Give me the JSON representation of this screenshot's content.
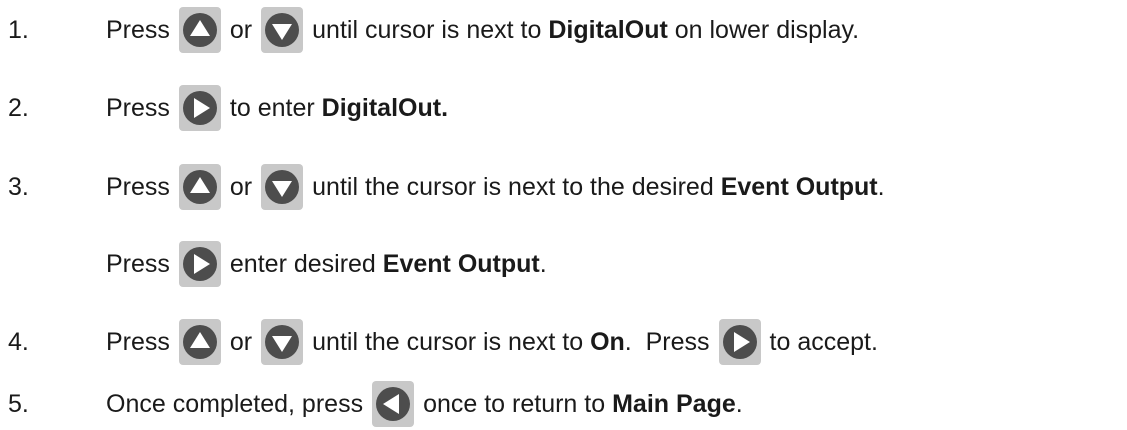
{
  "steps": [
    {
      "number": "1.",
      "parts": [
        "Press",
        "or",
        "until cursor is next to",
        "DigitalOut",
        "on lower display."
      ]
    },
    {
      "number": "2.",
      "parts": [
        "Press",
        "to enter",
        "DigitalOut."
      ]
    },
    {
      "number": "3.",
      "parts": [
        "Press",
        "or",
        "until the cursor is next to the desired",
        "Event Output",
        "."
      ]
    },
    {
      "number": "",
      "parts": [
        "Press",
        "enter desired",
        "Event Output",
        "."
      ]
    },
    {
      "number": "4.",
      "parts": [
        "Press",
        "or",
        "until the cursor is next to",
        "On",
        ".  Press",
        "to accept."
      ]
    },
    {
      "number": "5.",
      "parts": [
        "Once completed, press",
        "once to return to",
        "Main Page",
        "."
      ]
    }
  ],
  "icons": {
    "up": "up-arrow-button-icon",
    "down": "down-arrow-button-icon",
    "right": "right-arrow-button-icon",
    "left": "left-arrow-button-icon",
    "key_background": "#c8c8c8",
    "circle_color": "#4d4d4d"
  }
}
